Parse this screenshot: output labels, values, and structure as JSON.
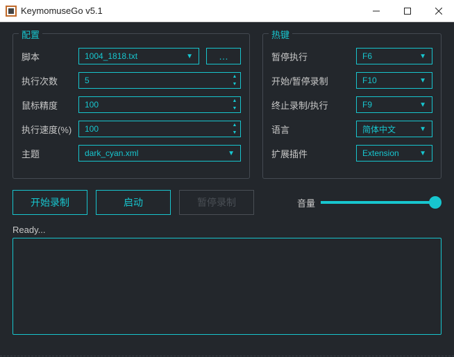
{
  "window": {
    "title": "KeymomuseGo v5.1"
  },
  "config": {
    "legend": "配置",
    "script_label": "脚本",
    "script_value": "1004_1818.txt",
    "browse_label": "…",
    "exec_count_label": "执行次数",
    "exec_count_value": "5",
    "mouse_precision_label": "鼠标精度",
    "mouse_precision_value": "100",
    "exec_speed_label": "执行速度(%)",
    "exec_speed_value": "100",
    "theme_label": "主题",
    "theme_value": "dark_cyan.xml"
  },
  "hotkeys": {
    "legend": "热键",
    "pause_exec_label": "暂停执行",
    "pause_exec_value": "F6",
    "start_pause_rec_label": "开始/暂停录制",
    "start_pause_rec_value": "F10",
    "stop_rec_exec_label": "终止录制/执行",
    "stop_rec_exec_value": "F9",
    "language_label": "语言",
    "language_value": "简体中文",
    "extension_label": "扩展插件",
    "extension_value": "Extension"
  },
  "actions": {
    "start_record": "开始录制",
    "start": "启动",
    "pause_record": "暂停录制",
    "volume_label": "音量"
  },
  "status_text": "Ready..."
}
